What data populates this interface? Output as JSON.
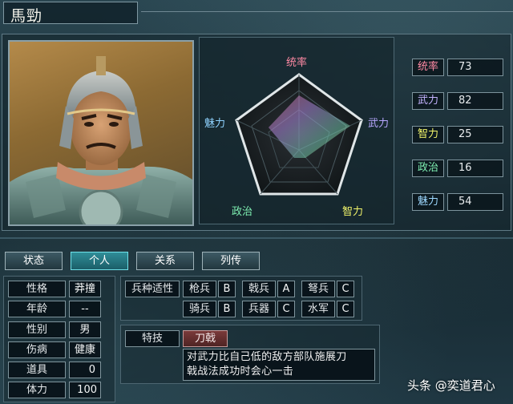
{
  "officer": {
    "name": "馬勁"
  },
  "radar": {
    "labels": {
      "lead": "统率",
      "war": "武力",
      "int": "智力",
      "pol": "政治",
      "cha": "魅力"
    },
    "colors": {
      "lead": "#ff8aa4",
      "war": "#b7a6ff",
      "int": "#f0f36a",
      "pol": "#7ff0b2",
      "cha": "#8fd3ff"
    }
  },
  "stats": [
    {
      "label": "统率",
      "value": "73",
      "color": "#ff8aa4"
    },
    {
      "label": "武力",
      "value": "82",
      "color": "#c4b3ff"
    },
    {
      "label": "智力",
      "value": "25",
      "color": "#f0f36a"
    },
    {
      "label": "政治",
      "value": "16",
      "color": "#7ff0b2"
    },
    {
      "label": "魅力",
      "value": "54",
      "color": "#9dd8ff"
    }
  ],
  "tabs": [
    "状态",
    "个人",
    "关系",
    "列传"
  ],
  "personal": {
    "personality_label": "性格",
    "personality_value": "莽撞",
    "age_label": "年龄",
    "age_value": "--",
    "gender_label": "性别",
    "gender_value": "男",
    "injury_label": "伤病",
    "injury_value": "健康",
    "item_label": "道具",
    "item_value": "0",
    "stamina_label": "体力",
    "stamina_value": "100"
  },
  "aptitude": {
    "title": "兵种适性",
    "spear_label": "枪兵",
    "spear_value": "B",
    "halberd_label": "戟兵",
    "halberd_value": "A",
    "bow_label": "弩兵",
    "bow_value": "C",
    "cavalry_label": "骑兵",
    "cavalry_value": "B",
    "siege_label": "兵器",
    "siege_value": "C",
    "navy_label": "水军",
    "navy_value": "C"
  },
  "skill": {
    "title": "特技",
    "name": "刀戟",
    "desc_line1": "对武力比自己低的敌方部队施展刀",
    "desc_line2": "戟战法成功时会心一击"
  },
  "watermark": "头条 @奕道君心"
}
